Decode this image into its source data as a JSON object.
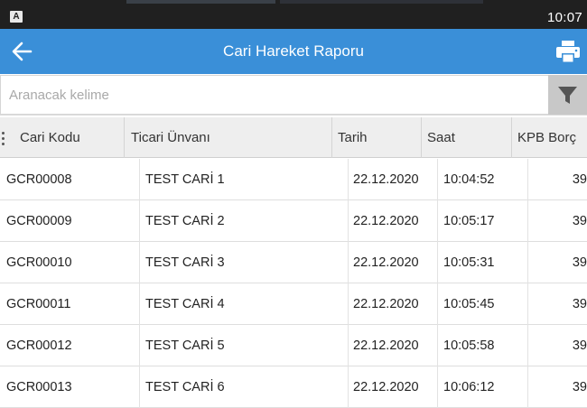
{
  "status_bar": {
    "app_icon_letter": "A",
    "time": "10:07"
  },
  "app_bar": {
    "title": "Cari Hareket Raporu",
    "back_icon": "arrow-left-icon",
    "print_icon": "printer-icon"
  },
  "search": {
    "placeholder": "Aranacak kelime",
    "value": "",
    "filter_icon": "filter-funnel-icon"
  },
  "grid": {
    "columns": [
      "Cari Kodu",
      "Ticari Ünvanı",
      "Tarih",
      "Saat",
      "KPB Borç"
    ],
    "rows": [
      {
        "code": "GCR00008",
        "name": "TEST CARİ 1",
        "date": "22.12.2020",
        "time": "10:04:52",
        "amount": "39"
      },
      {
        "code": "GCR00009",
        "name": "TEST CARİ 2",
        "date": "22.12.2020",
        "time": "10:05:17",
        "amount": "39"
      },
      {
        "code": "GCR00010",
        "name": "TEST CARİ 3",
        "date": "22.12.2020",
        "time": "10:05:31",
        "amount": "39"
      },
      {
        "code": "GCR00011",
        "name": "TEST CARİ 4",
        "date": "22.12.2020",
        "time": "10:05:45",
        "amount": "39"
      },
      {
        "code": "GCR00012",
        "name": "TEST CARİ 5",
        "date": "22.12.2020",
        "time": "10:05:58",
        "amount": "39"
      },
      {
        "code": "GCR00013",
        "name": "TEST CARİ 6",
        "date": "22.12.2020",
        "time": "10:06:12",
        "amount": "39"
      }
    ]
  },
  "colors": {
    "app_bar": "#3a8fd8",
    "status_bar": "#202020",
    "header_bg": "#eeeeee",
    "filter_bg": "#c8c8c8"
  }
}
